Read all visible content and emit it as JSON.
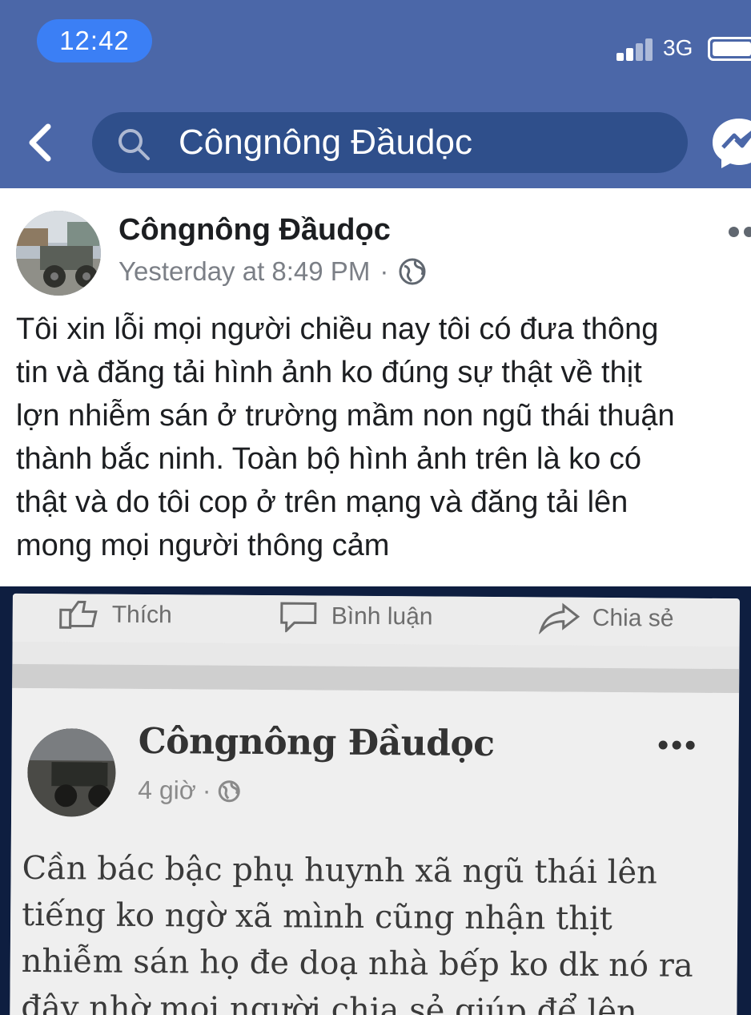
{
  "status_bar": {
    "time": "12:42",
    "network": "3G"
  },
  "search": {
    "query": "Côngnông Đầudọc"
  },
  "post": {
    "author": "Côngnông Đầudọc",
    "timestamp": "Yesterday at 8:49 PM",
    "separator": "·",
    "text": "Tôi xin lỗi mọi người chiều nay tôi có đưa thông\ntin và đăng tải hình ảnh ko đúng sự thật về thịt\nlợn nhiễm sán ở trường mầm non ngũ thái thuận\nthành bắc ninh. Toàn bộ hình ảnh trên là ko có\nthật và do tôi cop ở trên mạng và đăng tải lên\nmong mọi người thông cảm"
  },
  "photo": {
    "actions": [
      {
        "label": "Thích",
        "icon": "like-icon"
      },
      {
        "label": "Bình luận",
        "icon": "comment-icon"
      },
      {
        "label": "Chia sẻ",
        "icon": "share-icon"
      }
    ],
    "post": {
      "author": "Côngnông Đầudọc",
      "timestamp": "4 giờ",
      "separator": "·",
      "text": "Cần bác bậc phụ huynh xã ngũ thái lên\ntiếng ko ngờ xã mình cũng nhận thịt\nnhiễm sán họ đe doạ nhà bếp ko dk nó ra\nđây nhờ mọi người chia sẻ giúp để lên"
    }
  },
  "colors": {
    "nav_bar": "#4b67a8",
    "search_field": "#2f4f8b",
    "time_pill": "#3b7ff5",
    "text": "#1c1e21",
    "meta": "#7b7f86"
  }
}
